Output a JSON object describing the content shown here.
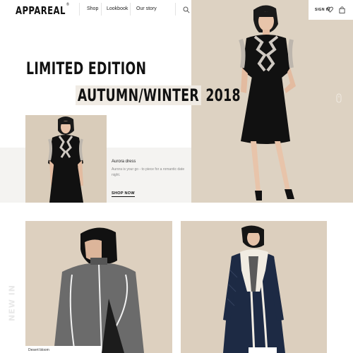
{
  "header": {
    "brand": "APPAREAL",
    "brand_mark": "®",
    "nav": [
      {
        "label": "Shop"
      },
      {
        "label": "Lookbook"
      },
      {
        "label": "Our story"
      }
    ],
    "search_icon": "search-icon",
    "signin_label": "SIGN IN",
    "wishlist_icon": "heart-icon",
    "cart_icon": "bag-icon"
  },
  "hero": {
    "headline_line1": "LIMITED EDITION",
    "headline_line2a": "AUTUMN/WINTER",
    "headline_line2b": "2018",
    "scroll_icon": "scroll-indicator-icon"
  },
  "featured": {
    "name": "Aurora dress",
    "description": "Aurora is your go - to piece for a romantic date night.",
    "cta": "SHOP NOW"
  },
  "new_in": {
    "label": "NEW IN",
    "caption": "Desert bloom"
  },
  "colors": {
    "accent_beige": "#ddd2c2",
    "band_grey": "#f4f3f1",
    "text": "#111111"
  }
}
